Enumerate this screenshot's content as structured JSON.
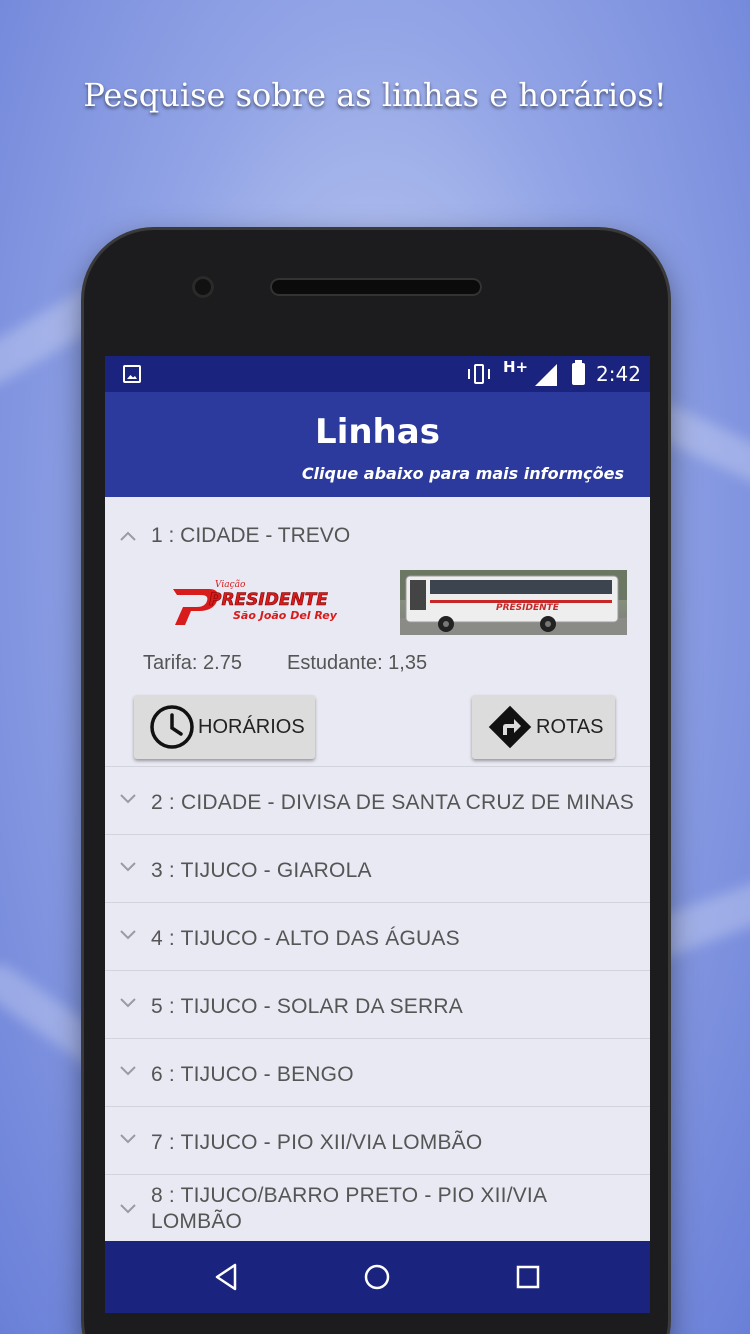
{
  "headline": "Pesquise sobre as linhas e horários!",
  "status_bar": {
    "network": "H+",
    "time": "2:42"
  },
  "app_bar": {
    "title": "Linhas",
    "subtitle": "Clique abaixo para mais informções"
  },
  "expanded_line": {
    "label": "1 : CIDADE - TREVO",
    "logo_text": {
      "top": "Viação",
      "brand": "PRESIDENTE",
      "city": "São João Del Rey"
    },
    "fare": "Tarifa: 2.75",
    "student": "Estudante: 1,35",
    "schedule_button": "HORÁRIOS",
    "routes_button": "ROTAS"
  },
  "lines": [
    {
      "label": "2 : CIDADE - DIVISA DE SANTA CRUZ DE MINAS"
    },
    {
      "label": "3 : TIJUCO - GIAROLA"
    },
    {
      "label": "4 : TIJUCO - ALTO DAS ÁGUAS"
    },
    {
      "label": "5 : TIJUCO - SOLAR DA SERRA"
    },
    {
      "label": "6 : TIJUCO - BENGO"
    },
    {
      "label": "7 : TIJUCO - PIO XII/VIA LOMBÃO"
    },
    {
      "label": "8 : TIJUCO/BARRO PRETO - PIO XII/VIA LOMBÃO"
    }
  ],
  "colors": {
    "status_bar": "#1a237e",
    "app_bar": "#2b3a9c",
    "list_bg": "#e8e9f3",
    "brand_red": "#d81b1b"
  },
  "icons": [
    "image-icon",
    "vibrate-icon",
    "signal-icon",
    "battery-icon",
    "clock-icon",
    "directions-icon",
    "back-icon",
    "home-icon",
    "recents-icon"
  ]
}
